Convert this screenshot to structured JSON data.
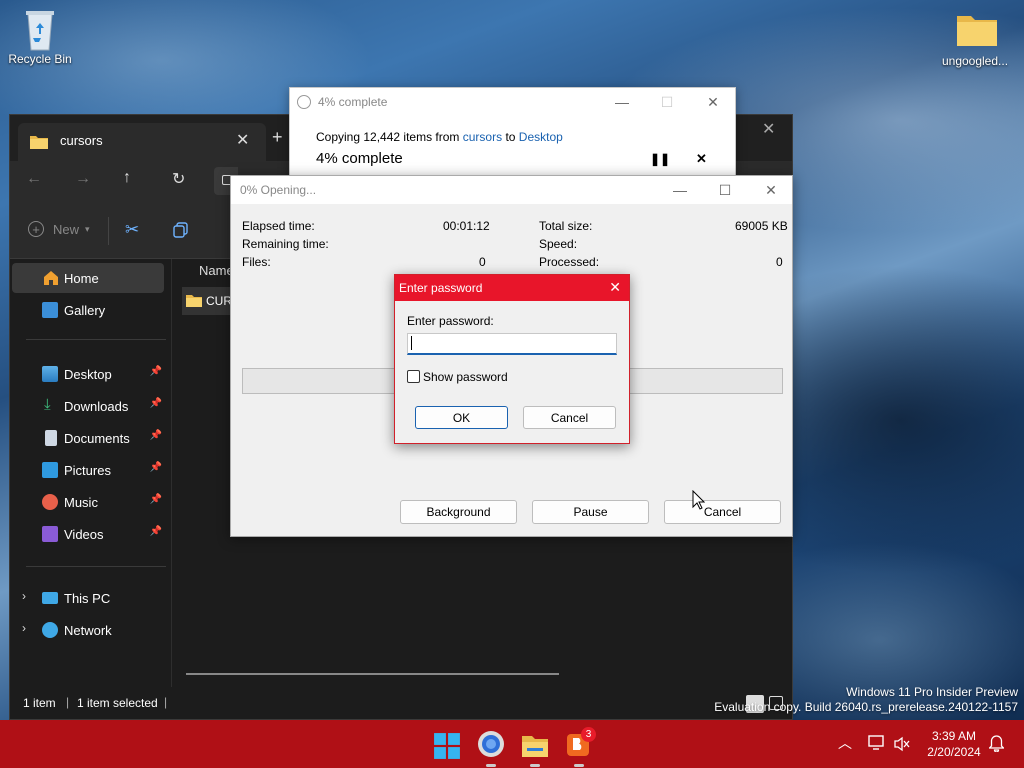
{
  "desktop": {
    "recycle_bin": "Recycle Bin",
    "folder": "ungoogled..."
  },
  "explorer": {
    "tab_title": "cursors",
    "new_label": "New",
    "column_name": "Name",
    "file_item": "CUR",
    "sidebar": {
      "home": "Home",
      "gallery": "Gallery",
      "desktop": "Desktop",
      "downloads": "Downloads",
      "documents": "Documents",
      "pictures": "Pictures",
      "music": "Music",
      "videos": "Videos",
      "this_pc": "This PC",
      "network": "Network"
    },
    "status": {
      "items": "1 item",
      "selected": "1 item selected"
    }
  },
  "copy_dialog": {
    "title": "4% complete",
    "line_prefix": "Copying 12,442 items from",
    "source": "cursors",
    "to": "to",
    "destination": "Desktop",
    "progress_text": "4% complete",
    "progress_fraction": 0.04
  },
  "zip_dialog": {
    "title": "0% Opening...",
    "elapsed_label": "Elapsed time:",
    "elapsed_value": "00:01:12",
    "remaining_label": "Remaining time:",
    "files_label": "Files:",
    "files_value": "0",
    "total_size_label": "Total size:",
    "total_size_value": "69005 KB",
    "speed_label": "Speed:",
    "processed_label": "Processed:",
    "processed_value": "0",
    "background_button": "Background",
    "pause_button": "Pause",
    "cancel_button": "Cancel"
  },
  "password_dialog": {
    "title": "Enter password",
    "label": "Enter password:",
    "value": "",
    "show_password": "Show password",
    "ok": "OK",
    "cancel": "Cancel"
  },
  "watermark": {
    "line1": "Windows 11 Pro Insider Preview",
    "line2": "Evaluation copy. Build 26040.rs_prerelease.240122-1157"
  },
  "taskbar": {
    "time": "3:39 AM",
    "date": "2/20/2024",
    "badge": "3"
  }
}
